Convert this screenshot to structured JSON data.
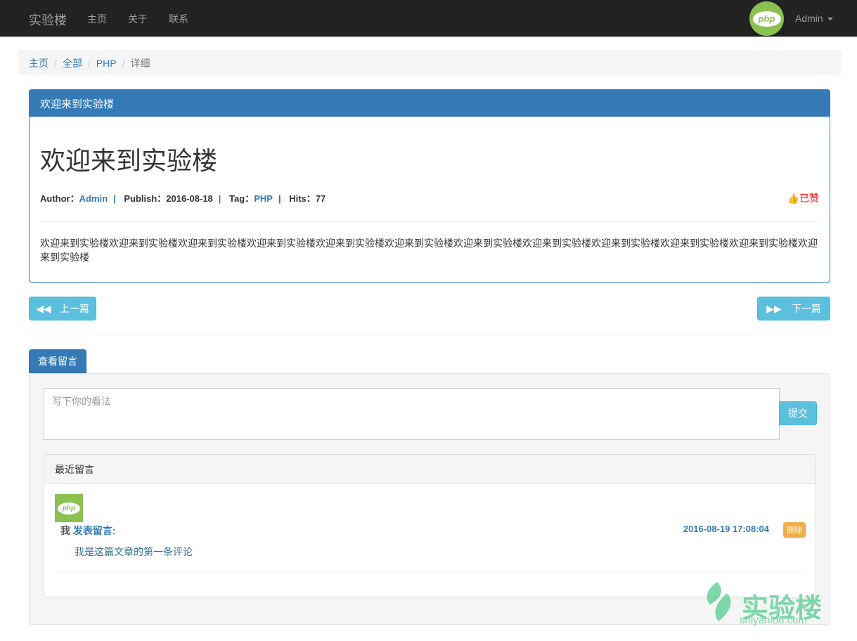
{
  "nav": {
    "brand": "实验楼",
    "links": [
      "主页",
      "关于",
      "联系"
    ],
    "avatar_text": "php",
    "user": "Admin"
  },
  "breadcrumb": [
    "主页",
    "全部",
    "PHP",
    "详细"
  ],
  "article": {
    "panel_title": "欢迎来到实验楼",
    "title": "欢迎来到实验楼",
    "author_label": "Author：",
    "author": "Admin",
    "publish_label": "Publish：",
    "publish": "2016-08-18",
    "tag_label": "Tag：",
    "tag": "PHP",
    "hits_label": "Hits：",
    "hits": "77",
    "sep": "|",
    "liked": "已赞",
    "body": "欢迎来到实验楼欢迎来到实验楼欢迎来到实验楼欢迎来到实验楼欢迎来到实验楼欢迎来到实验楼欢迎来到实验楼欢迎来到实验楼欢迎来到实验楼欢迎来到实验楼欢迎来到实验楼欢迎来到实验楼"
  },
  "pager": {
    "prev": "上一篇",
    "next": "下一篇"
  },
  "comments": {
    "toggle": "查看留言",
    "placeholder": "写下你的看法",
    "submit": "提交",
    "recent_title": "最近留言",
    "items": [
      {
        "avatar_text": "php",
        "who": "我",
        "action": "发表留言:",
        "date": "2016-08-19 17:08:04",
        "delete": "删除",
        "text": "我是这篇文章的第一条评论"
      }
    ]
  },
  "watermark": {
    "name": "实验楼",
    "url": "shiyanlou.com"
  }
}
